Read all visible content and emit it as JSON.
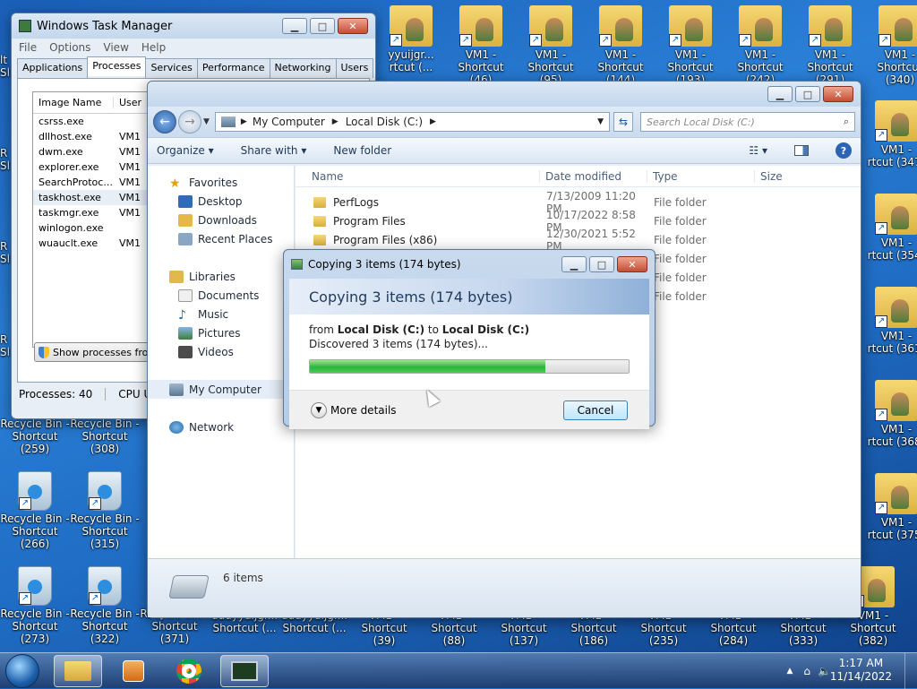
{
  "desktop": {
    "top_row": [
      {
        "label": "yyuijgr...\nrtcut (...",
        "type": "folder-user"
      },
      {
        "label": "VM1 -\nShortcut (46)",
        "type": "folder-user"
      },
      {
        "label": "VM1 -\nShortcut (95)",
        "type": "folder-user"
      },
      {
        "label": "VM1 -\nShortcut (144)",
        "type": "folder-user"
      },
      {
        "label": "VM1 -\nShortcut (193)",
        "type": "folder-user"
      },
      {
        "label": "VM1 -\nShortcut (242)",
        "type": "folder-user"
      },
      {
        "label": "VM1 -\nShortcut (291)",
        "type": "folder-user"
      },
      {
        "label": "VM1 -\nShortcut (340)",
        "type": "folder-user"
      }
    ],
    "right_col": [
      {
        "label": "VM1 -\nrtcut (347)"
      },
      {
        "label": "VM1 -\nrtcut (354)"
      },
      {
        "label": "VM1 -\nrtcut (361)"
      },
      {
        "label": "VM1 -\nrtcut (368)"
      },
      {
        "label": "VM1 -\nrtcut (375)"
      }
    ],
    "left_partial": [
      {
        "label": "lt\nSl"
      },
      {
        "label": "R\nSl"
      },
      {
        "label": "R\nSl"
      },
      {
        "label": "R\nSl"
      }
    ],
    "bins_row1": [
      {
        "label": "Recycle Bin -\nShortcut (259)"
      },
      {
        "label": "Recycle Bin -\nShortcut (308)"
      }
    ],
    "bins_row2": [
      {
        "label": "Recycle Bin -\nShortcut (266)"
      },
      {
        "label": "Recycle Bin -\nShortcut (315)"
      }
    ],
    "bottom_row": [
      {
        "label": "Recycle Bin -\nShortcut (273)"
      },
      {
        "label": "Recycle Bin -\nShortcut (322)"
      },
      {
        "label": "Recycle Bin -\nShortcut (371)"
      },
      {
        "label": "uuuyyuijgr...\nShortcut (..."
      },
      {
        "label": "uuuyyuijgr...\nShortcut (..."
      },
      {
        "label": "VM1 -\nShortcut (39)"
      },
      {
        "label": "VM1 -\nShortcut (88)"
      },
      {
        "label": "VM1 -\nShortcut (137)"
      },
      {
        "label": "VM1 -\nShortcut (186)"
      },
      {
        "label": "VM1 -\nShortcut (235)"
      },
      {
        "label": "VM1 -\nShortcut (284)"
      },
      {
        "label": "VM1 -\nShortcut (333)"
      },
      {
        "label": "VM1 -\nShortcut (382)"
      }
    ]
  },
  "task_manager": {
    "title": "Windows Task Manager",
    "menu": [
      "File",
      "Options",
      "View",
      "Help"
    ],
    "tabs": [
      "Applications",
      "Processes",
      "Services",
      "Performance",
      "Networking",
      "Users"
    ],
    "active_tab": "Processes",
    "columns": [
      "Image Name",
      "User"
    ],
    "processes": [
      {
        "name": "csrss.exe",
        "user": ""
      },
      {
        "name": "dllhost.exe",
        "user": "VM1"
      },
      {
        "name": "dwm.exe",
        "user": "VM1"
      },
      {
        "name": "explorer.exe",
        "user": "VM1"
      },
      {
        "name": "SearchProtoc...",
        "user": "VM1"
      },
      {
        "name": "taskhost.exe",
        "user": "VM1"
      },
      {
        "name": "taskmgr.exe",
        "user": "VM1"
      },
      {
        "name": "winlogon.exe",
        "user": ""
      },
      {
        "name": "wuauclt.exe",
        "user": "VM1"
      }
    ],
    "selected_process": "taskhost.exe",
    "show_processes_label": "Show processes from",
    "status_processes": "Processes: 40",
    "status_cpu": "CPU Us"
  },
  "explorer": {
    "breadcrumb": [
      "My Computer",
      "Local Disk (C:)"
    ],
    "search_placeholder": "Search Local Disk (C:)",
    "commands": [
      "Organize",
      "Share with",
      "New folder"
    ],
    "nav": {
      "favorites": {
        "label": "Favorites",
        "items": [
          "Desktop",
          "Downloads",
          "Recent Places"
        ]
      },
      "libraries": {
        "label": "Libraries",
        "items": [
          "Documents",
          "Music",
          "Pictures",
          "Videos"
        ]
      },
      "computer": "My Computer",
      "network": "Network"
    },
    "columns": [
      "Name",
      "Date modified",
      "Type",
      "Size"
    ],
    "files": [
      {
        "name": "PerfLogs",
        "date": "7/13/2009 11:20 PM",
        "type": "File folder"
      },
      {
        "name": "Program Files",
        "date": "10/17/2022 8:58 PM",
        "type": "File folder"
      },
      {
        "name": "Program Files (x86)",
        "date": "12/30/2021 5:52 PM",
        "type": "File folder"
      },
      {
        "name": "",
        "date": "",
        "type": "File folder"
      },
      {
        "name": "",
        "date": "",
        "type": "File folder"
      },
      {
        "name": "",
        "date": "",
        "type": "File folder"
      }
    ],
    "status": "6 items"
  },
  "copy_dialog": {
    "title": "Copying 3 items (174 bytes)",
    "header": "Copying 3 items (174 bytes)",
    "from_prefix": "from ",
    "from_src": "Local Disk (C:)",
    "to_word": " to ",
    "to_dst": "Local Disk (C:)",
    "discovered": "Discovered 3 items (174 bytes)...",
    "progress_fraction": 0.74,
    "more_details": "More details",
    "cancel": "Cancel"
  },
  "taskbar": {
    "time": "1:17 AM",
    "date": "11/14/2022"
  },
  "colors": {
    "accent": "#3c7fb1",
    "progress_green": "#2db53a",
    "close_red": "#c44e33"
  }
}
